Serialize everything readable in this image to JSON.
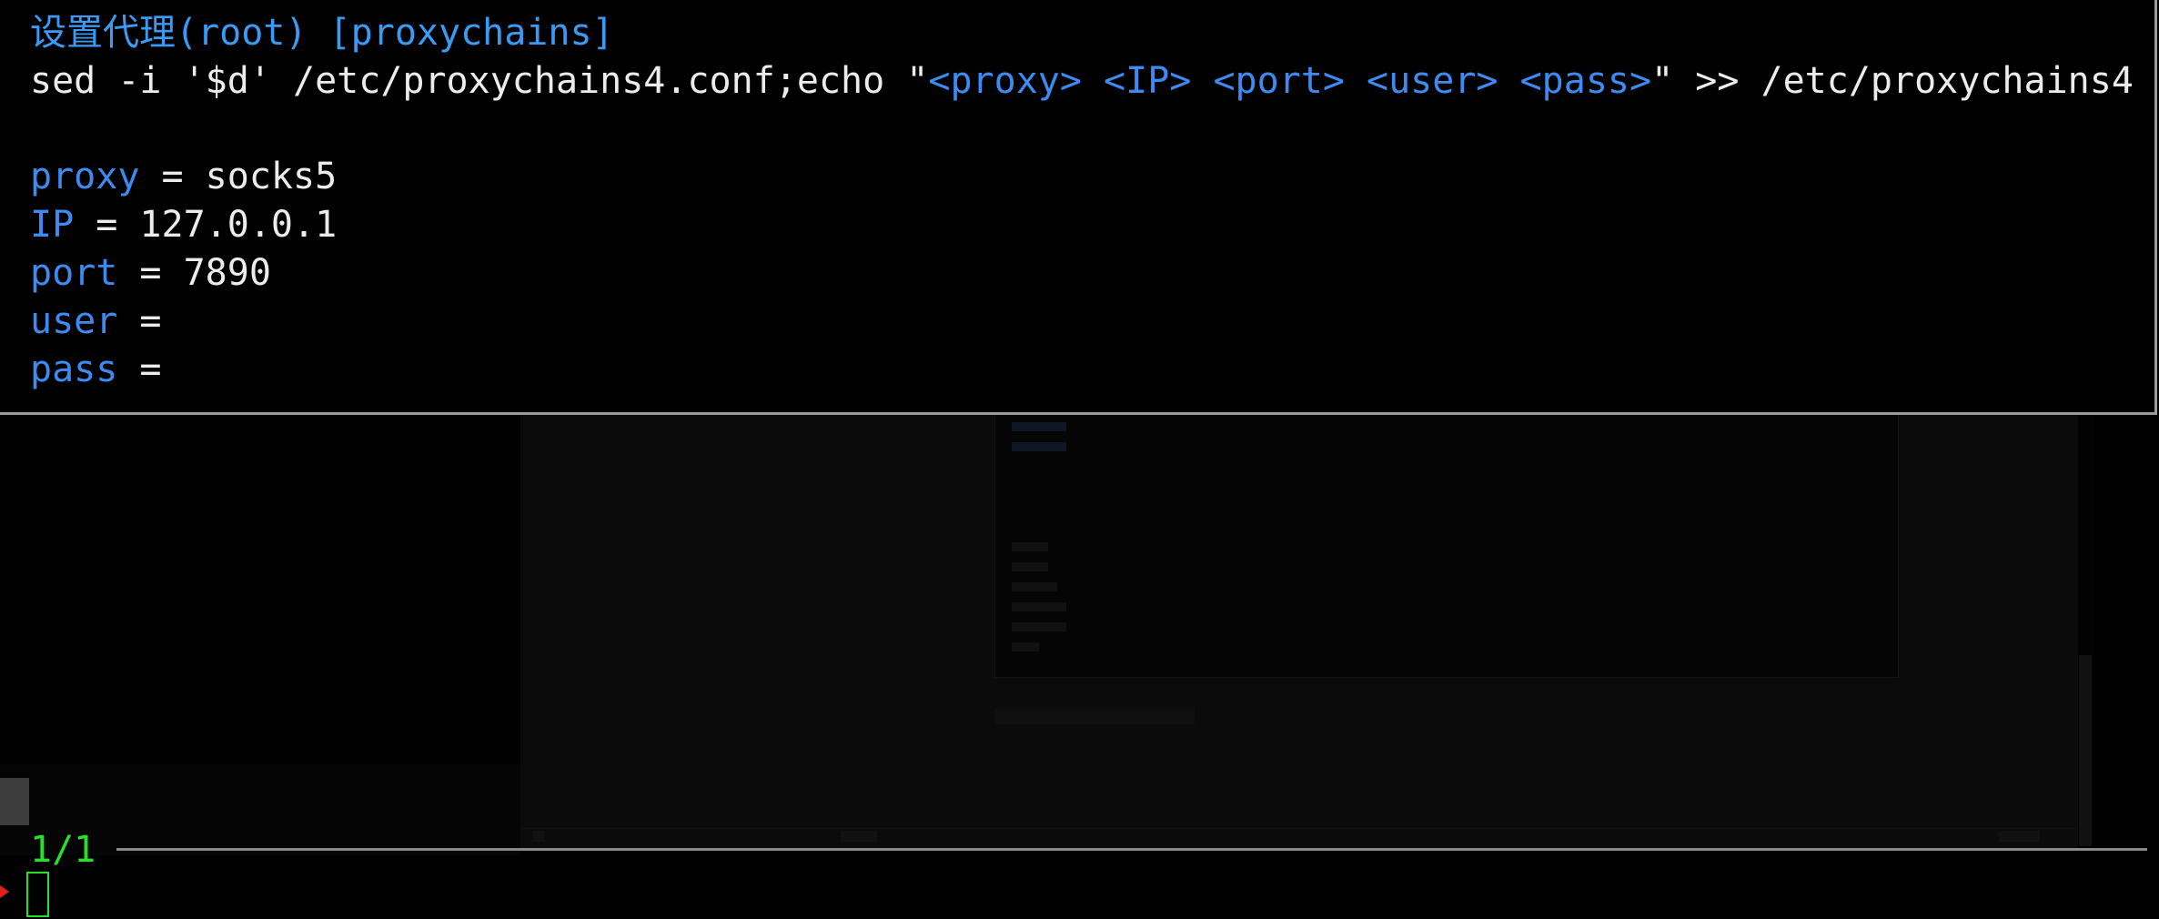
{
  "preview": {
    "title": "设置代理(root) [proxychains]",
    "command": {
      "prefix": "sed -i '$d' /etc/proxychains4.conf;echo \"",
      "placeholders": "<proxy> <IP> <port> <user> <pass>",
      "suffix": "\" >> /etc/proxychains4"
    },
    "params": [
      {
        "name": "proxy",
        "sep": " = ",
        "value": "socks5"
      },
      {
        "name": "IP",
        "sep": " = ",
        "value": "127.0.0.1"
      },
      {
        "name": "port",
        "sep": " = ",
        "value": "7890"
      },
      {
        "name": "user",
        "sep": " =",
        "value": ""
      },
      {
        "name": "pass",
        "sep": " =",
        "value": ""
      }
    ]
  },
  "finder": {
    "count": "1/1",
    "query": ""
  },
  "colors": {
    "title": "#3a9bf5",
    "param_name": "#3d8bf0",
    "placeholder": "#3d8bf0",
    "text": "#ececec",
    "count": "#27e02a",
    "cursor": "#27e02a",
    "prompt_arrow": "#e02020",
    "separator": "#8a8a8a",
    "preview_border": "#9a9a9a"
  }
}
